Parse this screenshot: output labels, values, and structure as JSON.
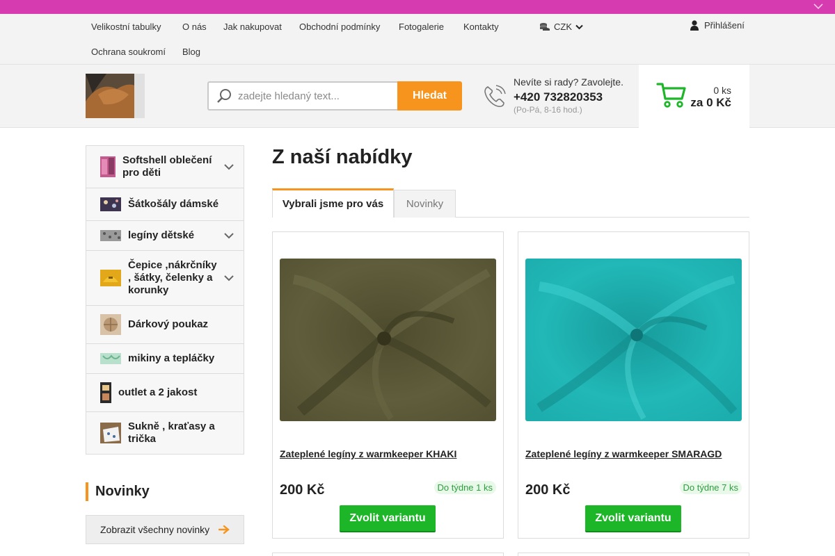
{
  "colors": {
    "topbar": "#d63bb0",
    "accent": "#f7941d",
    "cta": "#1eb629",
    "stock_text": "#2e9e3e"
  },
  "nav": {
    "links": [
      "Velikostní tabulky",
      "O nás",
      "Jak nakupovat",
      "Obchodní podmínky",
      "Fotogalerie",
      "Kontakty",
      "Ochrana soukromí",
      "Blog"
    ],
    "currency": "CZK",
    "login": "Přihlášení"
  },
  "search": {
    "placeholder": "zadejte hledaný text...",
    "button": "Hledat"
  },
  "contact": {
    "question": "Nevíte si rady? Zavolejte.",
    "phone": "+420 732820353",
    "hours": "(Po-Pá, 8-16 hod.)"
  },
  "cart": {
    "count": "0 ks",
    "total": "za 0 Kč"
  },
  "categories": [
    {
      "label": "Softshell oblečení pro děti",
      "expandable": true
    },
    {
      "label": "Šátkošály dámské",
      "expandable": false
    },
    {
      "label": "legíny dětské",
      "expandable": true
    },
    {
      "label": "Čepice ,nákrčníky , šátky, čelenky a korunky",
      "expandable": true
    },
    {
      "label": "Dárkový poukaz",
      "expandable": false
    },
    {
      "label": "mikiny a tepláčky",
      "expandable": false
    },
    {
      "label": "outlet a 2 jakost",
      "expandable": false
    },
    {
      "label": "Sukně , kraťasy a trička",
      "expandable": false
    }
  ],
  "novinky": {
    "title": "Novinky",
    "all_button": "Zobrazit všechny novinky"
  },
  "main": {
    "title": "Z naší nabídky",
    "tabs": [
      "Vybrali jsme pro vás",
      "Novinky"
    ]
  },
  "products": [
    {
      "name": "Zateplené legíny z warmkeeper KHAKI",
      "price": "200 Kč",
      "stock": "Do týdne 1 ks",
      "button": "Zvolit variantu",
      "fabric_color": "#5c5a38"
    },
    {
      "name": "Zateplené legíny z warmkeeper SMARAGD",
      "price": "200 Kč",
      "stock": "Do týdne 7 ks",
      "button": "Zvolit variantu",
      "fabric_color": "#1fb5b5"
    }
  ]
}
